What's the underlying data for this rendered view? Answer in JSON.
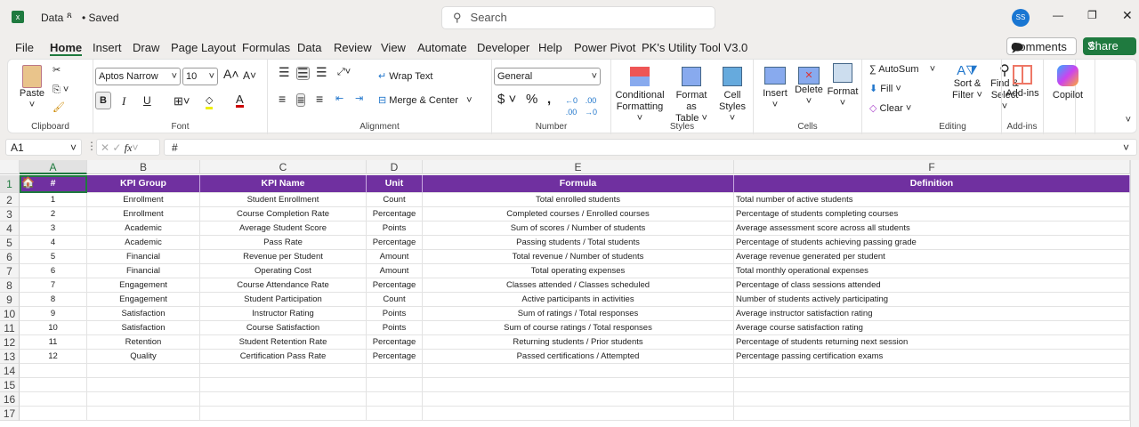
{
  "title_bar": {
    "file_name": "Data",
    "saved_status": "• Saved",
    "search_placeholder": "Search",
    "avatar": "SS"
  },
  "menu": [
    "File",
    "Home",
    "Insert",
    "Draw",
    "Page Layout",
    "Formulas",
    "Data",
    "Review",
    "View",
    "Automate",
    "Developer",
    "Help",
    "Power Pivot",
    "PK's Utility Tool V3.0"
  ],
  "actions": {
    "comments": "Comments",
    "share": "Share"
  },
  "ribbon": {
    "clipboard": {
      "paste": "Paste",
      "label": "Clipboard"
    },
    "font": {
      "name": "Aptos Narrow",
      "size": "10",
      "bold": "B",
      "italic": "I",
      "underline": "U",
      "label": "Font"
    },
    "alignment": {
      "wrap": "Wrap Text",
      "merge": "Merge & Center",
      "label": "Alignment"
    },
    "number": {
      "format": "General",
      "label": "Number"
    },
    "styles": {
      "cond": "Conditional",
      "cond2": "Formatting",
      "fat": "Format as",
      "fat2": "Table",
      "cell": "Cell",
      "cell2": "Styles",
      "label": "Styles"
    },
    "cells": {
      "insert": "Insert",
      "delete": "Delete",
      "format": "Format",
      "label": "Cells"
    },
    "editing": {
      "autosum": "AutoSum",
      "fill": "Fill",
      "clear": "Clear",
      "sort": "Sort &",
      "sort2": "Filter",
      "find": "Find &",
      "find2": "Select",
      "label": "Editing"
    },
    "addins": {
      "addins": "Add-ins",
      "label": "Add-ins"
    },
    "copilot": {
      "label": "Copilot"
    }
  },
  "formula_bar": {
    "name_box": "A1",
    "content": "#"
  },
  "columns": [
    "A",
    "B",
    "C",
    "D",
    "E",
    "F"
  ],
  "headers": [
    "#",
    "KPI Group",
    "KPI Name",
    "Unit",
    "Formula",
    "Definition"
  ],
  "rows": [
    [
      "1",
      "Enrollment",
      "Student Enrollment",
      "Count",
      "Total enrolled students",
      "Total number of active students"
    ],
    [
      "2",
      "Enrollment",
      "Course Completion Rate",
      "Percentage",
      "Completed courses / Enrolled courses",
      "Percentage of students completing courses"
    ],
    [
      "3",
      "Academic",
      "Average Student Score",
      "Points",
      "Sum of scores / Number of students",
      "Average assessment score across all students"
    ],
    [
      "4",
      "Academic",
      "Pass Rate",
      "Percentage",
      "Passing students / Total students",
      "Percentage of students achieving passing grade"
    ],
    [
      "5",
      "Financial",
      "Revenue per Student",
      "Amount",
      "Total revenue / Number of students",
      "Average revenue generated per student"
    ],
    [
      "6",
      "Financial",
      "Operating Cost",
      "Amount",
      "Total operating expenses",
      "Total monthly operational expenses"
    ],
    [
      "7",
      "Engagement",
      "Course Attendance Rate",
      "Percentage",
      "Classes attended / Classes scheduled",
      "Percentage of class sessions attended"
    ],
    [
      "8",
      "Engagement",
      "Student Participation",
      "Count",
      "Active participants in activities",
      "Number of students actively participating"
    ],
    [
      "9",
      "Satisfaction",
      "Instructor Rating",
      "Points",
      "Sum of ratings / Total responses",
      "Average instructor satisfaction rating"
    ],
    [
      "10",
      "Satisfaction",
      "Course Satisfaction",
      "Points",
      "Sum of course ratings / Total responses",
      "Average course satisfaction rating"
    ],
    [
      "11",
      "Retention",
      "Student Retention Rate",
      "Percentage",
      "Returning students / Prior students",
      "Percentage of students returning next session"
    ],
    [
      "12",
      "Quality",
      "Certification Pass Rate",
      "Percentage",
      "Passed certifications / Attempted",
      "Percentage passing certification exams"
    ]
  ],
  "row_numbers": [
    "1",
    "2",
    "3",
    "4",
    "5",
    "6",
    "7",
    "8",
    "9",
    "10",
    "11",
    "12",
    "13",
    "14",
    "15",
    "16",
    "17"
  ],
  "colors": {
    "header": "#7030A0",
    "excel_green": "#1f7a3f"
  }
}
